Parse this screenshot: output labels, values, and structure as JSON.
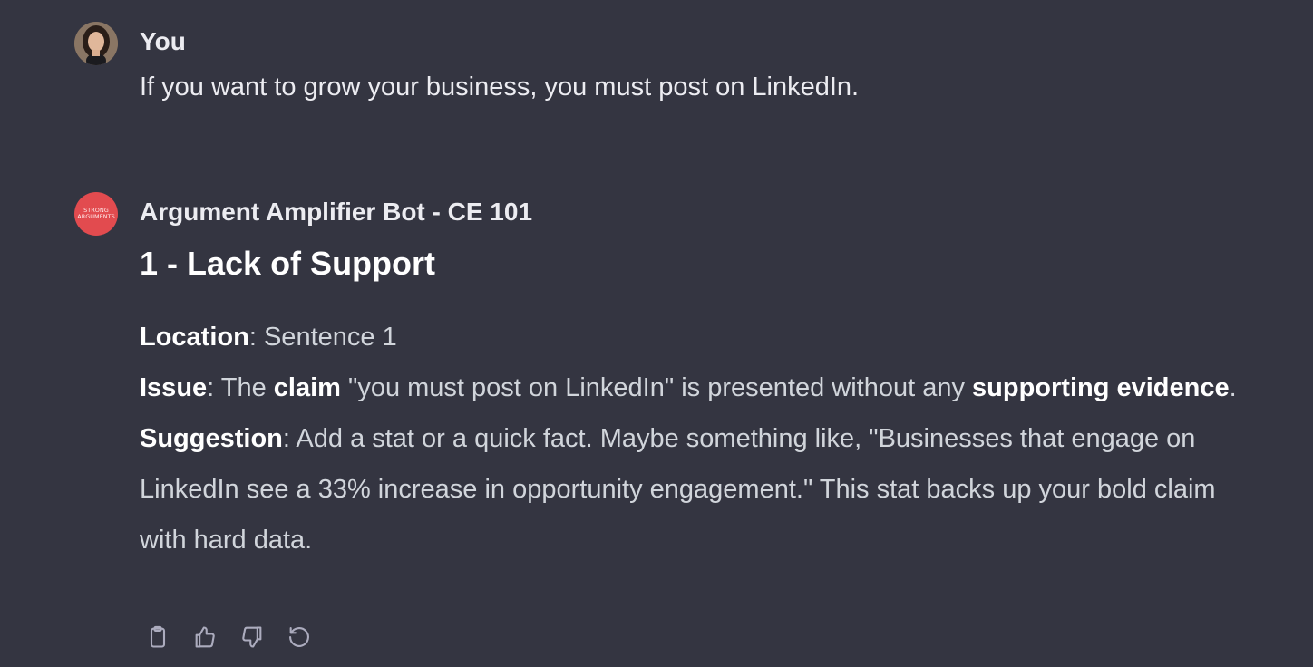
{
  "user_message": {
    "author": "You",
    "text": "If you want to grow your business, you must post on LinkedIn.",
    "avatar_icon": "user-photo-avatar"
  },
  "bot_message": {
    "author": "Argument Amplifier Bot - CE 101",
    "avatar_icon": "strong-arguments-logo",
    "avatar_line1": "STRONG",
    "avatar_line2": "ARGUMENTS",
    "heading": "1 - Lack of Support",
    "location": {
      "label": "Location",
      "sep": ": ",
      "value": "Sentence 1"
    },
    "issue": {
      "label": "Issue",
      "sep": ": ",
      "part1": "The ",
      "bold1": "claim",
      "part2": " \"you must post on LinkedIn\" is presented without any ",
      "bold2": "supporting evidence",
      "part3": "."
    },
    "suggestion": {
      "label": "Suggestion",
      "sep": ": ",
      "text": "Add a stat or a quick fact. Maybe something like, \"Businesses that engage on LinkedIn see a 33% increase in opportunity engagement.\" This stat backs up your bold claim with hard data."
    },
    "actions": [
      {
        "name": "copy",
        "icon": "clipboard-icon"
      },
      {
        "name": "thumbs-up",
        "icon": "thumbs-up-icon"
      },
      {
        "name": "thumbs-down",
        "icon": "thumbs-down-icon"
      },
      {
        "name": "regenerate",
        "icon": "regenerate-icon"
      }
    ]
  },
  "colors": {
    "background": "#343541",
    "text": "#ececf1",
    "muted_text": "#d1d5db",
    "bot_avatar": "#e24b4f",
    "icon": "#acacbe"
  }
}
